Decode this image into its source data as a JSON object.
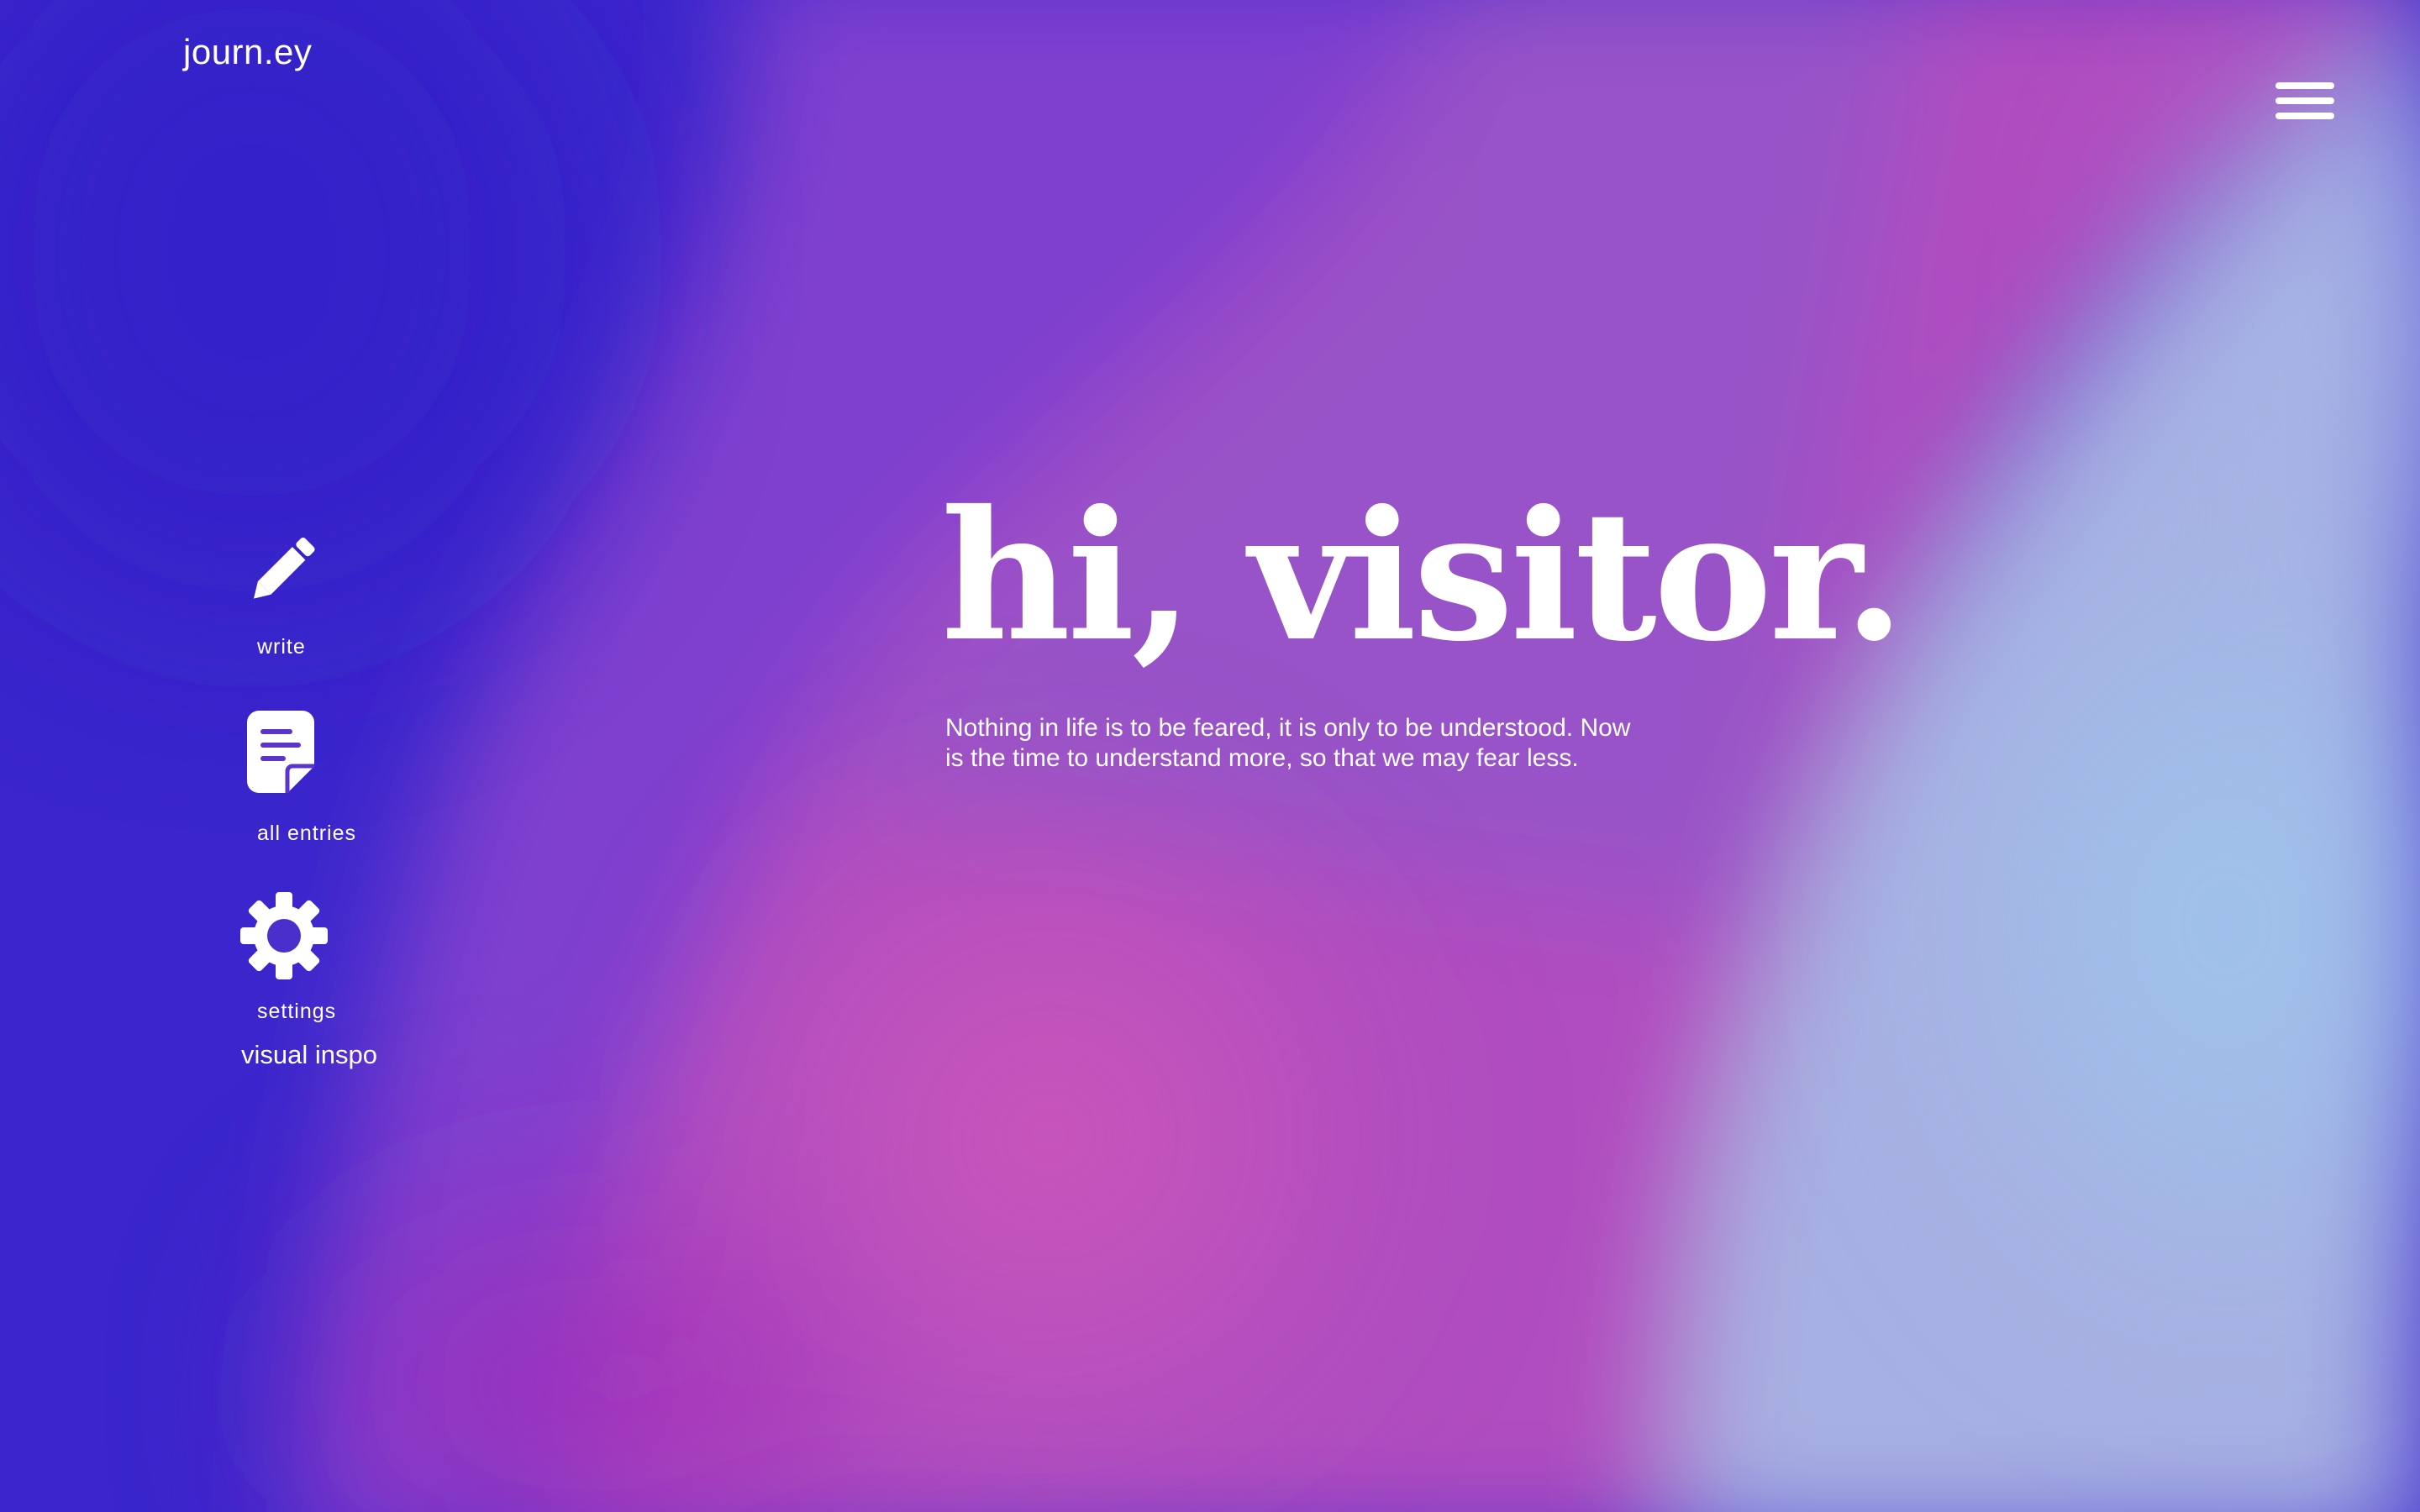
{
  "app": {
    "logo": "journ.ey"
  },
  "header": {
    "menu_icon": "hamburger-menu-icon"
  },
  "nav": {
    "items": [
      {
        "label": "write",
        "icon": "pencil-icon"
      },
      {
        "label": "all entries",
        "icon": "document-icon"
      },
      {
        "label": "settings",
        "icon": "gear-icon"
      }
    ],
    "extra_link": "visual inspo"
  },
  "hero": {
    "title": "hi, visitor.",
    "subtitle": "Nothing in life is to be feared, it is only to be understood. Now is the time to understand more, so that we may fear less."
  },
  "colors": {
    "deep_blue": "#3a26cc",
    "violet": "#7b3ad0",
    "magenta": "#c04fb6",
    "lavender": "#a9a3de",
    "sky_blue": "#9cc4ec",
    "text": "#ffffff"
  }
}
